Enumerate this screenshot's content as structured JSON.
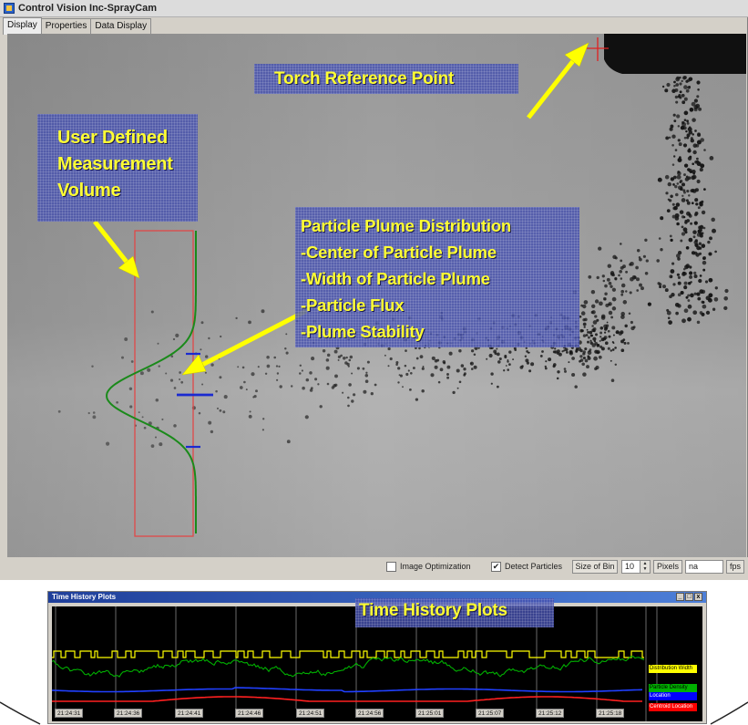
{
  "window": {
    "title": "Control Vision Inc-SprayCam",
    "tabs": [
      "Display",
      "Properties",
      "Data Display"
    ],
    "active_tab": "Display"
  },
  "annotations": {
    "torch": "Torch Reference Point",
    "user_volume": [
      "User Defined",
      "Measurement",
      "Volume"
    ],
    "plume": [
      "Particle Plume Distribution",
      "-Center of Particle Plume",
      "-Width of Particle Plume",
      "-Particle Flux",
      "-Plume Stability"
    ],
    "time_history": "Time History Plots"
  },
  "controls": {
    "image_optimization": {
      "label": "Image Optimization",
      "checked": false
    },
    "detect_particles": {
      "label": "Detect Particles",
      "checked": true
    },
    "size_of_bin_label": "Size of Bin",
    "size_of_bin_value": "10",
    "pixels_label": "Pixels",
    "fps_value": "na",
    "fps_unit": "fps"
  },
  "time_history": {
    "title": "Time History Plots",
    "window_buttons": [
      "_",
      "□",
      "x"
    ],
    "legend": [
      {
        "name": "Distribution Width",
        "color": "#ffff00"
      },
      {
        "name": "Particle Density",
        "color": "#00b000"
      },
      {
        "name": "Location",
        "color": "#0000ff"
      },
      {
        "name": "Centroid Location",
        "color": "#ff0000"
      }
    ],
    "time_labels": [
      "21:24:31",
      "21:24:36",
      "21:24:41",
      "21:24:46",
      "21:24:51",
      "21:24:56",
      "21:25:01",
      "21:25:07",
      "21:25:12",
      "21:25:18"
    ]
  },
  "colors": {
    "callout_text": "#ffff33",
    "arrow": "#ffff00",
    "measurement_box": "#e04040",
    "distribution_curve": "#1a8a1a",
    "plume_markers": "#1a2ad0"
  }
}
